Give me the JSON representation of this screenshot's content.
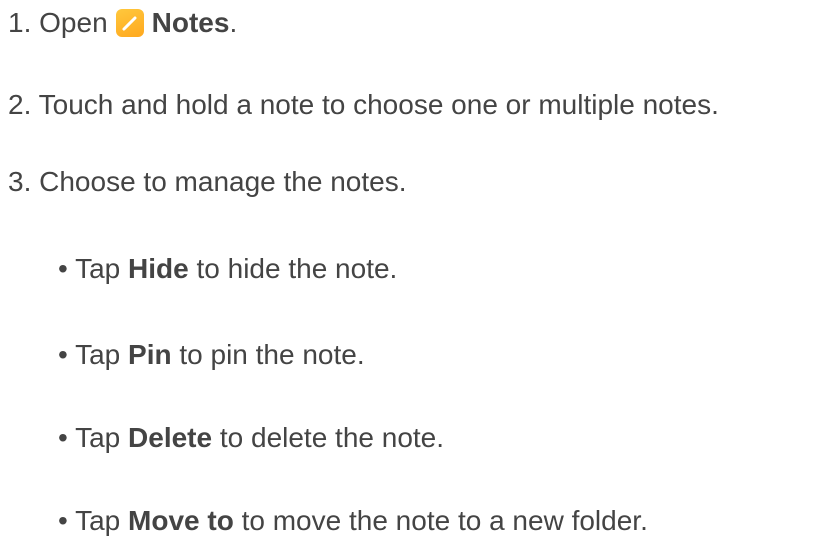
{
  "steps": [
    {
      "number": "1.",
      "prefix": "Open",
      "app_name": "Notes",
      "suffix": "."
    },
    {
      "number": "2.",
      "text": "Touch and hold a note to choose one or multiple notes."
    },
    {
      "number": "3.",
      "text": "Choose to manage the notes."
    }
  ],
  "options": [
    {
      "bullet": "•",
      "prefix": "Tap",
      "action": "Hide",
      "suffix": "to hide the note."
    },
    {
      "bullet": "•",
      "prefix": "Tap",
      "action": "Pin",
      "suffix": "to pin the note."
    },
    {
      "bullet": "•",
      "prefix": "Tap",
      "action": "Delete",
      "suffix": "to delete the note."
    },
    {
      "bullet": "•",
      "prefix": "Tap",
      "action": "Move to",
      "suffix": "to move the note to a new folder."
    }
  ],
  "icons": {
    "notes_app": "notes-app-icon"
  },
  "colors": {
    "text": "#444444",
    "icon": "#ffb22c"
  }
}
